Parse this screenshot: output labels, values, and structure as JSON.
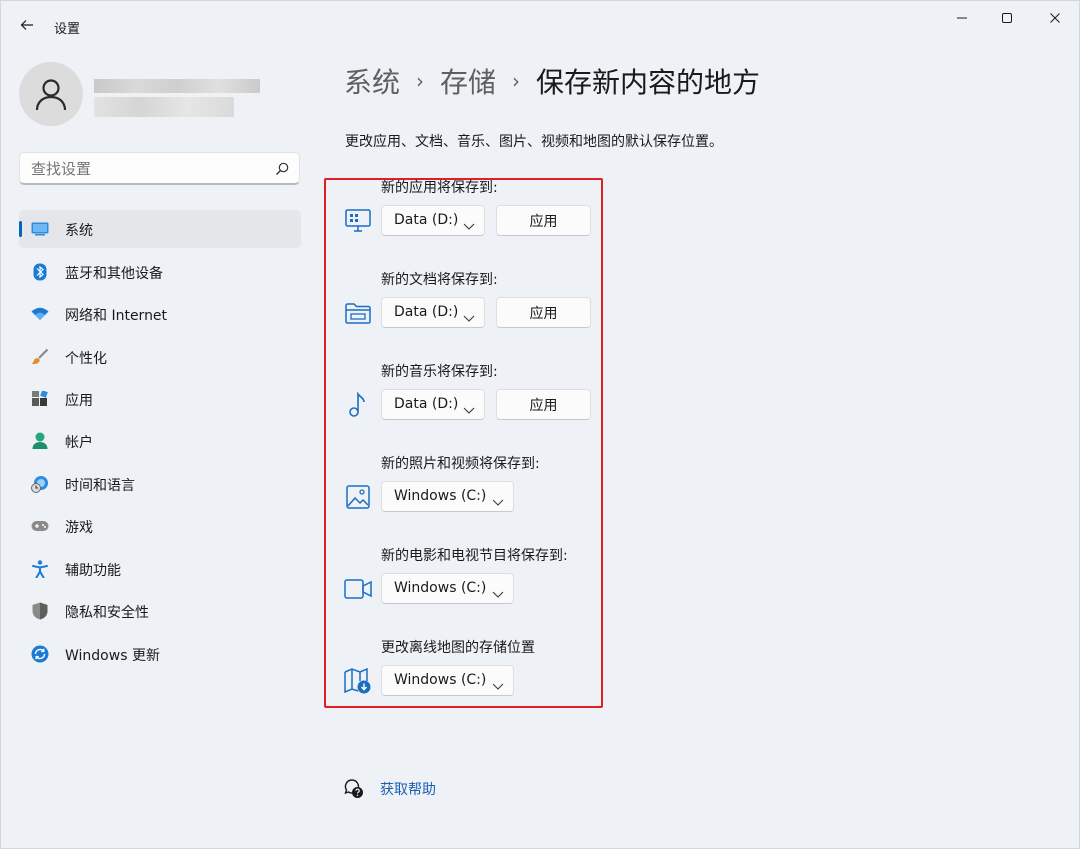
{
  "window": {
    "title": "设置",
    "back_icon": "back-arrow-icon",
    "controls": [
      "minimize-icon",
      "maximize-icon",
      "close-icon"
    ]
  },
  "user": {
    "avatar_icon": "user-avatar-icon"
  },
  "search": {
    "placeholder": "查找设置",
    "icon": "search-icon"
  },
  "sidebar": {
    "items": [
      {
        "label": "系统",
        "icon": "system-display-icon",
        "active": true
      },
      {
        "label": "蓝牙和其他设备",
        "icon": "bluetooth-icon"
      },
      {
        "label": "网络和 Internet",
        "icon": "wifi-icon"
      },
      {
        "label": "个性化",
        "icon": "paintbrush-icon"
      },
      {
        "label": "应用",
        "icon": "apps-icon"
      },
      {
        "label": "帐户",
        "icon": "account-icon"
      },
      {
        "label": "时间和语言",
        "icon": "time-language-icon"
      },
      {
        "label": "游戏",
        "icon": "gamepad-icon"
      },
      {
        "label": "辅助功能",
        "icon": "accessibility-icon"
      },
      {
        "label": "隐私和安全性",
        "icon": "shield-icon"
      },
      {
        "label": "Windows 更新",
        "icon": "windows-update-icon"
      }
    ]
  },
  "breadcrumb": {
    "parent1": "系统",
    "parent2": "存储",
    "current": "保存新内容的地方",
    "separator": "›"
  },
  "description": "更改应用、文档、音乐、图片、视频和地图的默认保存位置。",
  "save_locations": [
    {
      "label": "新的应用将保存到:",
      "icon": "apps-monitor-icon",
      "value": "Data (D:)",
      "apply": "应用"
    },
    {
      "label": "新的文档将保存到:",
      "icon": "folder-documents-icon",
      "value": "Data (D:)",
      "apply": "应用"
    },
    {
      "label": "新的音乐将保存到:",
      "icon": "music-note-icon",
      "value": "Data (D:)",
      "apply": "应用"
    },
    {
      "label": "新的照片和视频将保存到:",
      "icon": "picture-icon",
      "value": "Windows (C:)"
    },
    {
      "label": "新的电影和电视节目将保存到:",
      "icon": "video-camera-icon",
      "value": "Windows (C:)"
    },
    {
      "label": "更改离线地图的存储位置",
      "icon": "offline-map-icon",
      "value": "Windows (C:)"
    }
  ],
  "help": {
    "label": "获取帮助",
    "icon": "help-chat-icon"
  },
  "colors": {
    "accent": "#0067c0",
    "highlight_border": "#e02020",
    "link": "#1a5fb4"
  }
}
